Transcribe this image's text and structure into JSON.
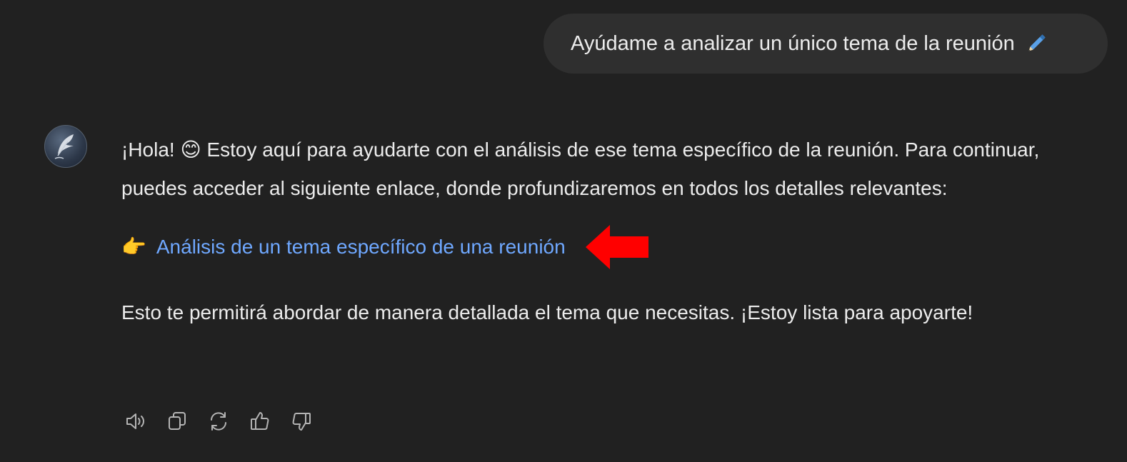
{
  "user_message": {
    "text": "Ayúdame a analizar un único tema de la reunión",
    "icon": "pen-icon"
  },
  "assistant_message": {
    "avatar_icon": "feather-quill-icon",
    "intro": "¡Hola! 😊 Estoy aquí para ayudarte con el análisis de ese tema específico de la reunión. Para continuar, puedes acceder al siguiente enlace, donde profundizaremos en todos los detalles relevantes:",
    "link_emoji": "👉",
    "link_text": "Análisis de un tema específico de una reunión",
    "outro": "Esto te permitirá abordar de manera detallada el tema que necesitas. ¡Estoy lista para apoyarte!"
  },
  "annotation": {
    "icon": "red-arrow-left-icon",
    "color": "#ff0000"
  },
  "actions": [
    {
      "icon": "read-aloud-icon"
    },
    {
      "icon": "copy-icon"
    },
    {
      "icon": "regenerate-icon"
    },
    {
      "icon": "thumbs-up-icon"
    },
    {
      "icon": "thumbs-down-icon"
    }
  ],
  "colors": {
    "background": "#212121",
    "user_bubble": "#2f2f2f",
    "text": "#ececec",
    "link": "#6fa8ff"
  }
}
